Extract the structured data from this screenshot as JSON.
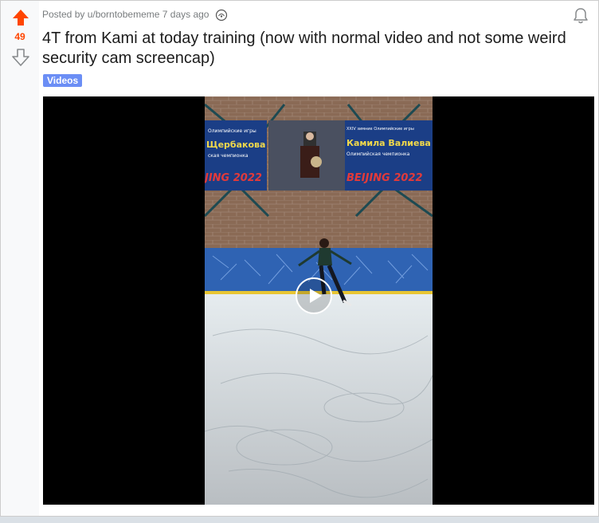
{
  "post": {
    "score": "49",
    "posted_by": "Posted by u/borntobememe 7 days ago",
    "title": "4T from Kami at today training (now with normal video and not some weird security cam screencap)",
    "flair": "Videos"
  },
  "banner": {
    "left_line1": "Олимпийские игры",
    "left_name": "Щербакова",
    "left_sub": "ская чемпионка",
    "left_event": "JING 2022",
    "right_line1": "XXIV зимние Олимпийские игры",
    "right_name": "Камила Валиева",
    "right_sub": "Олимпийская чемпионка",
    "right_event": "BEIJING 2022"
  },
  "icons": {
    "upvote": "upvote-arrow-icon",
    "downvote": "downvote-arrow-icon",
    "coin": "award-coin-icon",
    "bell": "notification-bell-icon",
    "play": "play-icon"
  },
  "colors": {
    "upvote": "#ff4500",
    "flair": "#6b8ef5"
  }
}
